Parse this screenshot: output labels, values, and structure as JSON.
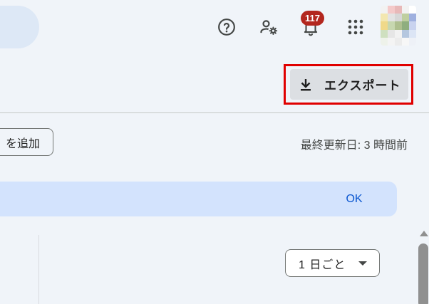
{
  "header": {
    "notification_count": "117",
    "icons": [
      "help-icon",
      "admin-settings-icon",
      "notification-bell-icon",
      "apps-grid-icon",
      "avatar"
    ],
    "avatar_colors": [
      "#f2f2f2",
      "#f4c9c9",
      "#e8b8b8",
      "#f2f2f2",
      "#ffffff",
      "#f3e7b0",
      "#e3e3e3",
      "#d7d7d7",
      "#bfcf9f",
      "#9fb0df",
      "#f0d98a",
      "#c7d7b0",
      "#aebf8f",
      "#8fae7f",
      "#c9d3ef",
      "#cfe0c0",
      "#e6e6e6",
      "#f2f2f2",
      "#b5c7df",
      "#dce5f5",
      "#eef2ea",
      "#f4f4f4",
      "#ececec",
      "#f7f7f7",
      "#eef1f7"
    ]
  },
  "toolbar": {
    "export_label": "エクスポート",
    "export_icon": "download-icon",
    "highlight_color": "#e00000"
  },
  "main": {
    "add_button_label": "を追加",
    "last_updated": "最終更新日: 3 時間前",
    "banner": {
      "ok_label": "OK"
    },
    "period_select": {
      "selected": "1 日ごと"
    }
  }
}
